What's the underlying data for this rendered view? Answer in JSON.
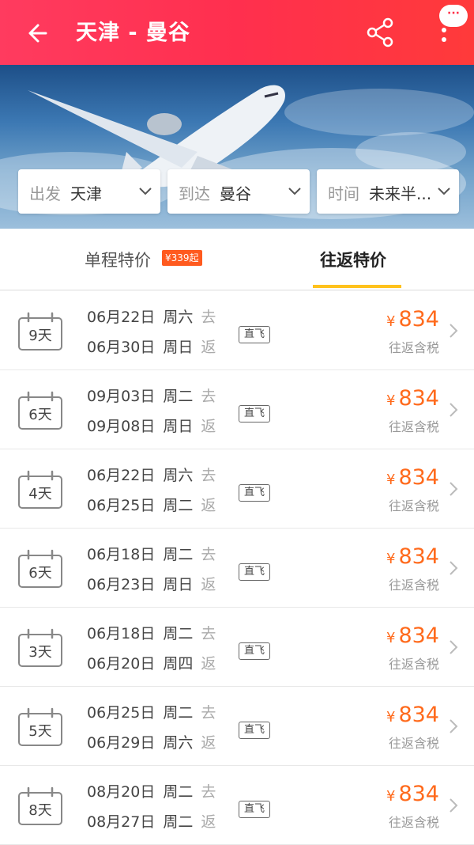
{
  "header": {
    "title": "天津 - 曼谷",
    "badge": "···"
  },
  "filters": [
    {
      "label": "出发",
      "value": "天津"
    },
    {
      "label": "到达",
      "value": "曼谷"
    },
    {
      "label": "时间",
      "value": "未来半..."
    }
  ],
  "tabs": {
    "one_way": {
      "label": "单程特价",
      "badge": "¥339起"
    },
    "round_trip": {
      "label": "往返特价",
      "active": true
    }
  },
  "rows": [
    {
      "days": "9天",
      "depart_date": "06月22日",
      "depart_wd": "周六",
      "depart_dir": "去",
      "return_date": "06月30日",
      "return_wd": "周日",
      "return_dir": "返",
      "tag": "直飞",
      "currency": "¥",
      "price": "834",
      "tax": "往返含税"
    },
    {
      "days": "6天",
      "depart_date": "09月03日",
      "depart_wd": "周二",
      "depart_dir": "去",
      "return_date": "09月08日",
      "return_wd": "周日",
      "return_dir": "返",
      "tag": "直飞",
      "currency": "¥",
      "price": "834",
      "tax": "往返含税"
    },
    {
      "days": "4天",
      "depart_date": "06月22日",
      "depart_wd": "周六",
      "depart_dir": "去",
      "return_date": "06月25日",
      "return_wd": "周二",
      "return_dir": "返",
      "tag": "直飞",
      "currency": "¥",
      "price": "834",
      "tax": "往返含税"
    },
    {
      "days": "6天",
      "depart_date": "06月18日",
      "depart_wd": "周二",
      "depart_dir": "去",
      "return_date": "06月23日",
      "return_wd": "周日",
      "return_dir": "返",
      "tag": "直飞",
      "currency": "¥",
      "price": "834",
      "tax": "往返含税"
    },
    {
      "days": "3天",
      "depart_date": "06月18日",
      "depart_wd": "周二",
      "depart_dir": "去",
      "return_date": "06月20日",
      "return_wd": "周四",
      "return_dir": "返",
      "tag": "直飞",
      "currency": "¥",
      "price": "834",
      "tax": "往返含税"
    },
    {
      "days": "5天",
      "depart_date": "06月25日",
      "depart_wd": "周二",
      "depart_dir": "去",
      "return_date": "06月29日",
      "return_wd": "周六",
      "return_dir": "返",
      "tag": "直飞",
      "currency": "¥",
      "price": "834",
      "tax": "往返含税"
    },
    {
      "days": "8天",
      "depart_date": "08月20日",
      "depart_wd": "周二",
      "depart_dir": "去",
      "return_date": "08月27日",
      "return_wd": "周二",
      "return_dir": "返",
      "tag": "直飞",
      "currency": "¥",
      "price": "834",
      "tax": "往返含税"
    }
  ],
  "icons": {
    "back": "arrow-left-icon",
    "share": "share-icon",
    "more": "more-vertical-icon",
    "calendar": "calendar-icon",
    "chevron": "chevron-right-icon"
  },
  "colors": {
    "header": "#ff3355",
    "price": "#ff6a1c",
    "badge": "#ff5a1f",
    "tab_underline": "#ffc21c"
  }
}
